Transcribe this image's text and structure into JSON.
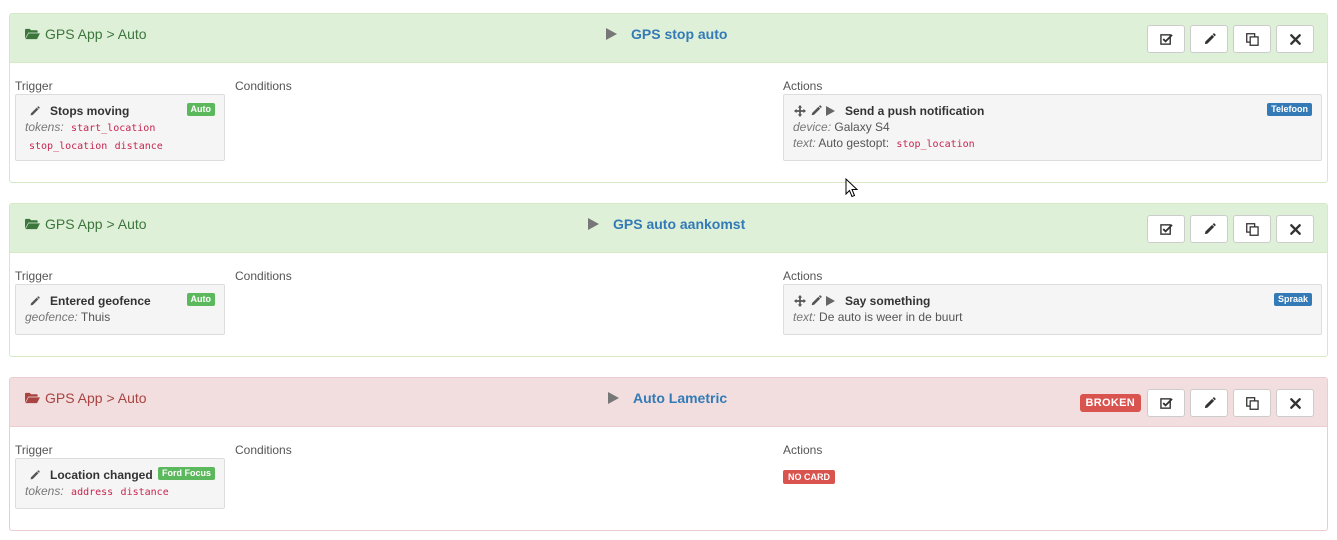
{
  "flows": [
    {
      "folder": "GPS App > Auto",
      "title": "GPS stop auto",
      "labels": {
        "trigger": "Trigger",
        "conditions": "Conditions",
        "actions": "Actions"
      },
      "trigger": {
        "title": "Stops moving",
        "badge": "Auto",
        "arg_label": "tokens",
        "tokens": [
          "start_location",
          "stop_location",
          "distance"
        ]
      },
      "action": {
        "title": "Send a push notification",
        "badge": "Telefoon",
        "device_label": "device",
        "device_value": "Galaxy S4",
        "text_label": "text",
        "text_value": "Auto gestopt:",
        "text_token": "stop_location"
      }
    },
    {
      "folder": "GPS App > Auto",
      "title": "GPS auto aankomst",
      "labels": {
        "trigger": "Trigger",
        "conditions": "Conditions",
        "actions": "Actions"
      },
      "trigger": {
        "title": "Entered geofence",
        "badge": "Auto",
        "arg_label": "geofence",
        "arg_value": "Thuis"
      },
      "action": {
        "title": "Say something",
        "badge": "Spraak",
        "text_label": "text",
        "text_value": "De auto is weer in de buurt"
      }
    },
    {
      "folder": "GPS App > Auto",
      "title": "Auto Lametric",
      "status": "BROKEN",
      "labels": {
        "trigger": "Trigger",
        "conditions": "Conditions",
        "actions": "Actions"
      },
      "trigger": {
        "title": "Location changed",
        "badge": "Ford Focus",
        "arg_label": "tokens",
        "tokens": [
          "address",
          "distance"
        ]
      },
      "no_card": "NO CARD"
    }
  ],
  "icons": {
    "folder": "folder-open-icon",
    "play": "play-icon",
    "enable": "checkbox-icon",
    "edit": "pencil-icon",
    "duplicate": "copy-icon",
    "delete": "close-icon",
    "move": "move-icon"
  },
  "colors": {
    "header_ok": "#dff0d8",
    "header_broken": "#f2dede",
    "title_link": "#337ab7",
    "badge_green": "#5cb85c",
    "badge_blue": "#337ab7",
    "danger": "#d9534f",
    "token": "#c7254e"
  }
}
